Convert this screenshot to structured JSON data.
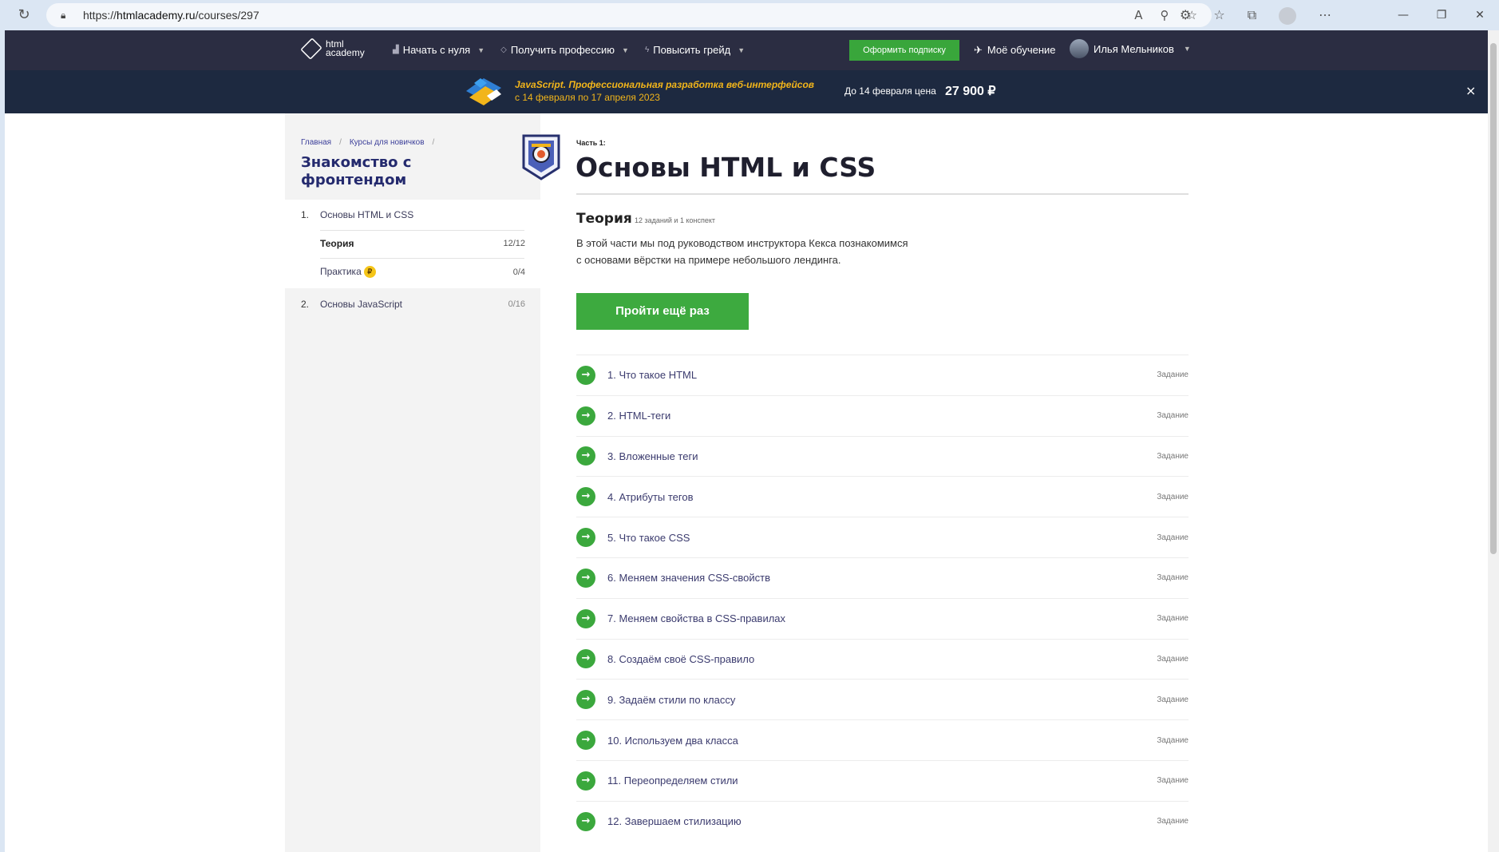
{
  "browser": {
    "url_prefix": "https://",
    "url_domain": "htmlacademy.ru",
    "url_path": "/courses/297",
    "window_controls": [
      "—",
      "❐",
      "✕"
    ]
  },
  "header": {
    "logo_line1": "html",
    "logo_line2": "academy",
    "nav": [
      {
        "label": "Начать с нуля",
        "icon": "bar-chart-icon"
      },
      {
        "label": "Получить профессию",
        "icon": "diamond-icon"
      },
      {
        "label": "Повысить грейд",
        "icon": "lightning-icon"
      }
    ],
    "subscribe_label": "Оформить подписку",
    "my_learning_label": "Моё обучение",
    "user_name": "Илья Мельников"
  },
  "promo": {
    "title": "JavaScript. Профессиональная разработка веб-интерфейсов",
    "dates": "с 14 февраля по 17 апреля 2023",
    "price_label": "До 14 февраля цена",
    "price": "27 900 ₽",
    "close": "×"
  },
  "sidebar": {
    "breadcrumbs": [
      "Главная",
      "Курсы для новичков"
    ],
    "course_title": "Знакомство с фронтендом",
    "parts": [
      {
        "num": "1.",
        "title": "Основы HTML и CSS"
      },
      {
        "num": "2.",
        "title": "Основы JavaScript",
        "count": "0/16"
      }
    ],
    "subitems": [
      {
        "label": "Теория",
        "count": "12/12"
      },
      {
        "label": "Практика",
        "count": "0/4",
        "coin": "₽"
      }
    ]
  },
  "main": {
    "part_label": "Часть 1:",
    "part_title": "Основы HTML и CSS",
    "theory_heading": "Теория",
    "theory_meta": "12 заданий и 1 конспект",
    "theory_desc_line1": "В этой части мы под руководством инструктора Кекса познакомимся",
    "theory_desc_line2": "с основами вёрстки на примере небольшого лендинга.",
    "retry_label": "Пройти ещё раз",
    "lessons": [
      {
        "title": "1. Что такое HTML",
        "type": "Задание"
      },
      {
        "title": "2. HTML-теги",
        "type": "Задание"
      },
      {
        "title": "3. Вложенные теги",
        "type": "Задание"
      },
      {
        "title": "4. Атрибуты тегов",
        "type": "Задание"
      },
      {
        "title": "5. Что такое CSS",
        "type": "Задание"
      },
      {
        "title": "6. Меняем значения CSS-свойств",
        "type": "Задание"
      },
      {
        "title": "7. Меняем свойства в CSS-правилах",
        "type": "Задание"
      },
      {
        "title": "8. Создаём своё CSS-правило",
        "type": "Задание"
      },
      {
        "title": "9. Задаём стили по классу",
        "type": "Задание"
      },
      {
        "title": "10. Используем два класса",
        "type": "Задание"
      },
      {
        "title": "11. Переопределяем стили",
        "type": "Задание"
      },
      {
        "title": "12. Завершаем стилизацию",
        "type": "Задание"
      }
    ]
  },
  "colors": {
    "header_bg": "#2b2d42",
    "promo_bg": "#1d2940",
    "promo_text": "#f2b51a",
    "accent_green": "#3daa3f",
    "title_blue": "#242a6e"
  }
}
